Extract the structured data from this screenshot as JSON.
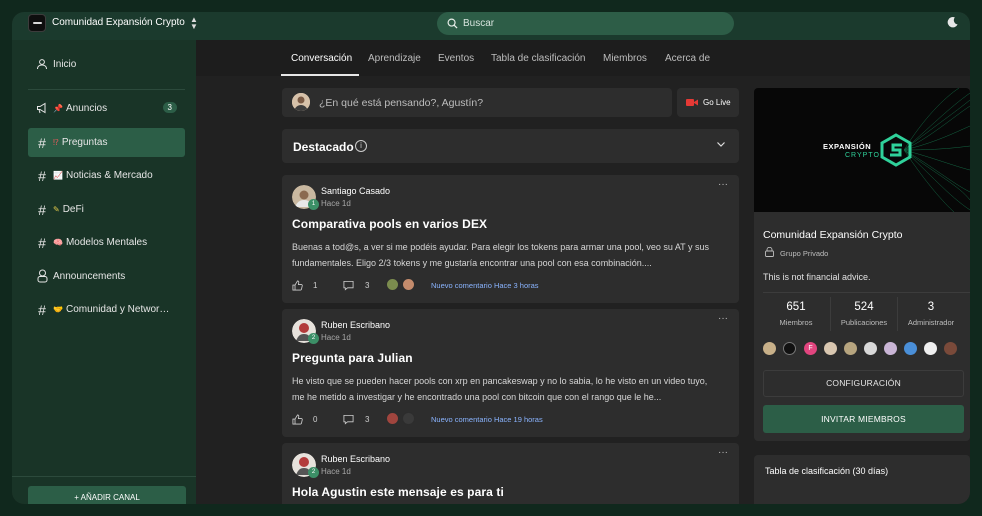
{
  "header": {
    "community_name": "Comunidad Expansión Crypto",
    "search_placeholder": "Buscar"
  },
  "sidebar": {
    "items": [
      {
        "label": "Inicio",
        "icon": "person-icon"
      },
      {
        "label": "Anuncios",
        "icon": "megaphone-icon",
        "emoji": "📌",
        "badge": "3"
      },
      {
        "label": "Preguntas",
        "icon": "hash-icon",
        "emoji": "⁉️",
        "active": true
      },
      {
        "label": "Noticias & Mercado",
        "icon": "hash-icon",
        "emoji": "📈"
      },
      {
        "label": "DeFi",
        "icon": "hash-icon",
        "emoji": "🖊️"
      },
      {
        "label": "Modelos Mentales",
        "icon": "hash-icon",
        "emoji": "🧠"
      },
      {
        "label": "Announcements",
        "icon": "robot-icon"
      },
      {
        "label": "Comunidad y Networ…",
        "icon": "hash-icon",
        "emoji": "🤝"
      }
    ],
    "add_channel": "+ AÑADIR CANAL"
  },
  "tabs": [
    "Conversación",
    "Aprendizaje",
    "Eventos",
    "Tabla de clasificación",
    "Miembros",
    "Acerca de"
  ],
  "active_tab": "Conversación",
  "composer": {
    "placeholder": "¿En qué está pensando?, Agustín?",
    "go_live": "Go Live"
  },
  "featured": {
    "title": "Destacado"
  },
  "posts": [
    {
      "author": "Santiago Casado",
      "level": "1",
      "time": "Hace 1d",
      "title": "Comparativa pools en varios DEX",
      "body": "Buenas a tod@s, a ver si me podéis ayudar. Para elegir los tokens para armar una pool, veo su AT y sus fundamentales. Eligo 2/3 tokens y me gustaría encontrar una pool con esa combinación....",
      "likes": "1",
      "comments": "3",
      "new_comment": "Nuevo comentario Hace 3 horas"
    },
    {
      "author": "Ruben Escribano",
      "level": "2",
      "time": "Hace 1d",
      "title": "Pregunta para Julian",
      "body": "He visto que se pueden hacer pools con xrp en pancakeswap y no lo sabia, lo he visto en un video tuyo, me he metido a investigar y he encontrado una pool con bitcoin que con el rango que le he...",
      "likes": "0",
      "comments": "3",
      "new_comment": "Nuevo comentario Hace 19 horas"
    },
    {
      "author": "Ruben Escribano",
      "level": "2",
      "time": "Hace 1d",
      "title": "Hola Agustin este mensaje es para ti"
    }
  ],
  "community_card": {
    "banner_title": "EXPANSIÓN",
    "banner_sub": "CRYPTO",
    "name": "Comunidad Expansión Crypto",
    "privacy": "Grupo Privado",
    "description": "This is not financial advice.",
    "stats": [
      {
        "value": "651",
        "label": "Miembros"
      },
      {
        "value": "524",
        "label": "Publicaciones"
      },
      {
        "value": "3",
        "label": "Administrador"
      }
    ],
    "settings_label": "CONFIGURACIÓN",
    "invite_label": "INVITAR MIEMBROS"
  },
  "leaderboard": {
    "title": "Tabla de clasificación (30 días)"
  },
  "colors": {
    "accent": "#2c5e47",
    "header_bg": "#1b3a2d",
    "sidebar_bg": "#193427",
    "link": "#8ab4ff"
  }
}
